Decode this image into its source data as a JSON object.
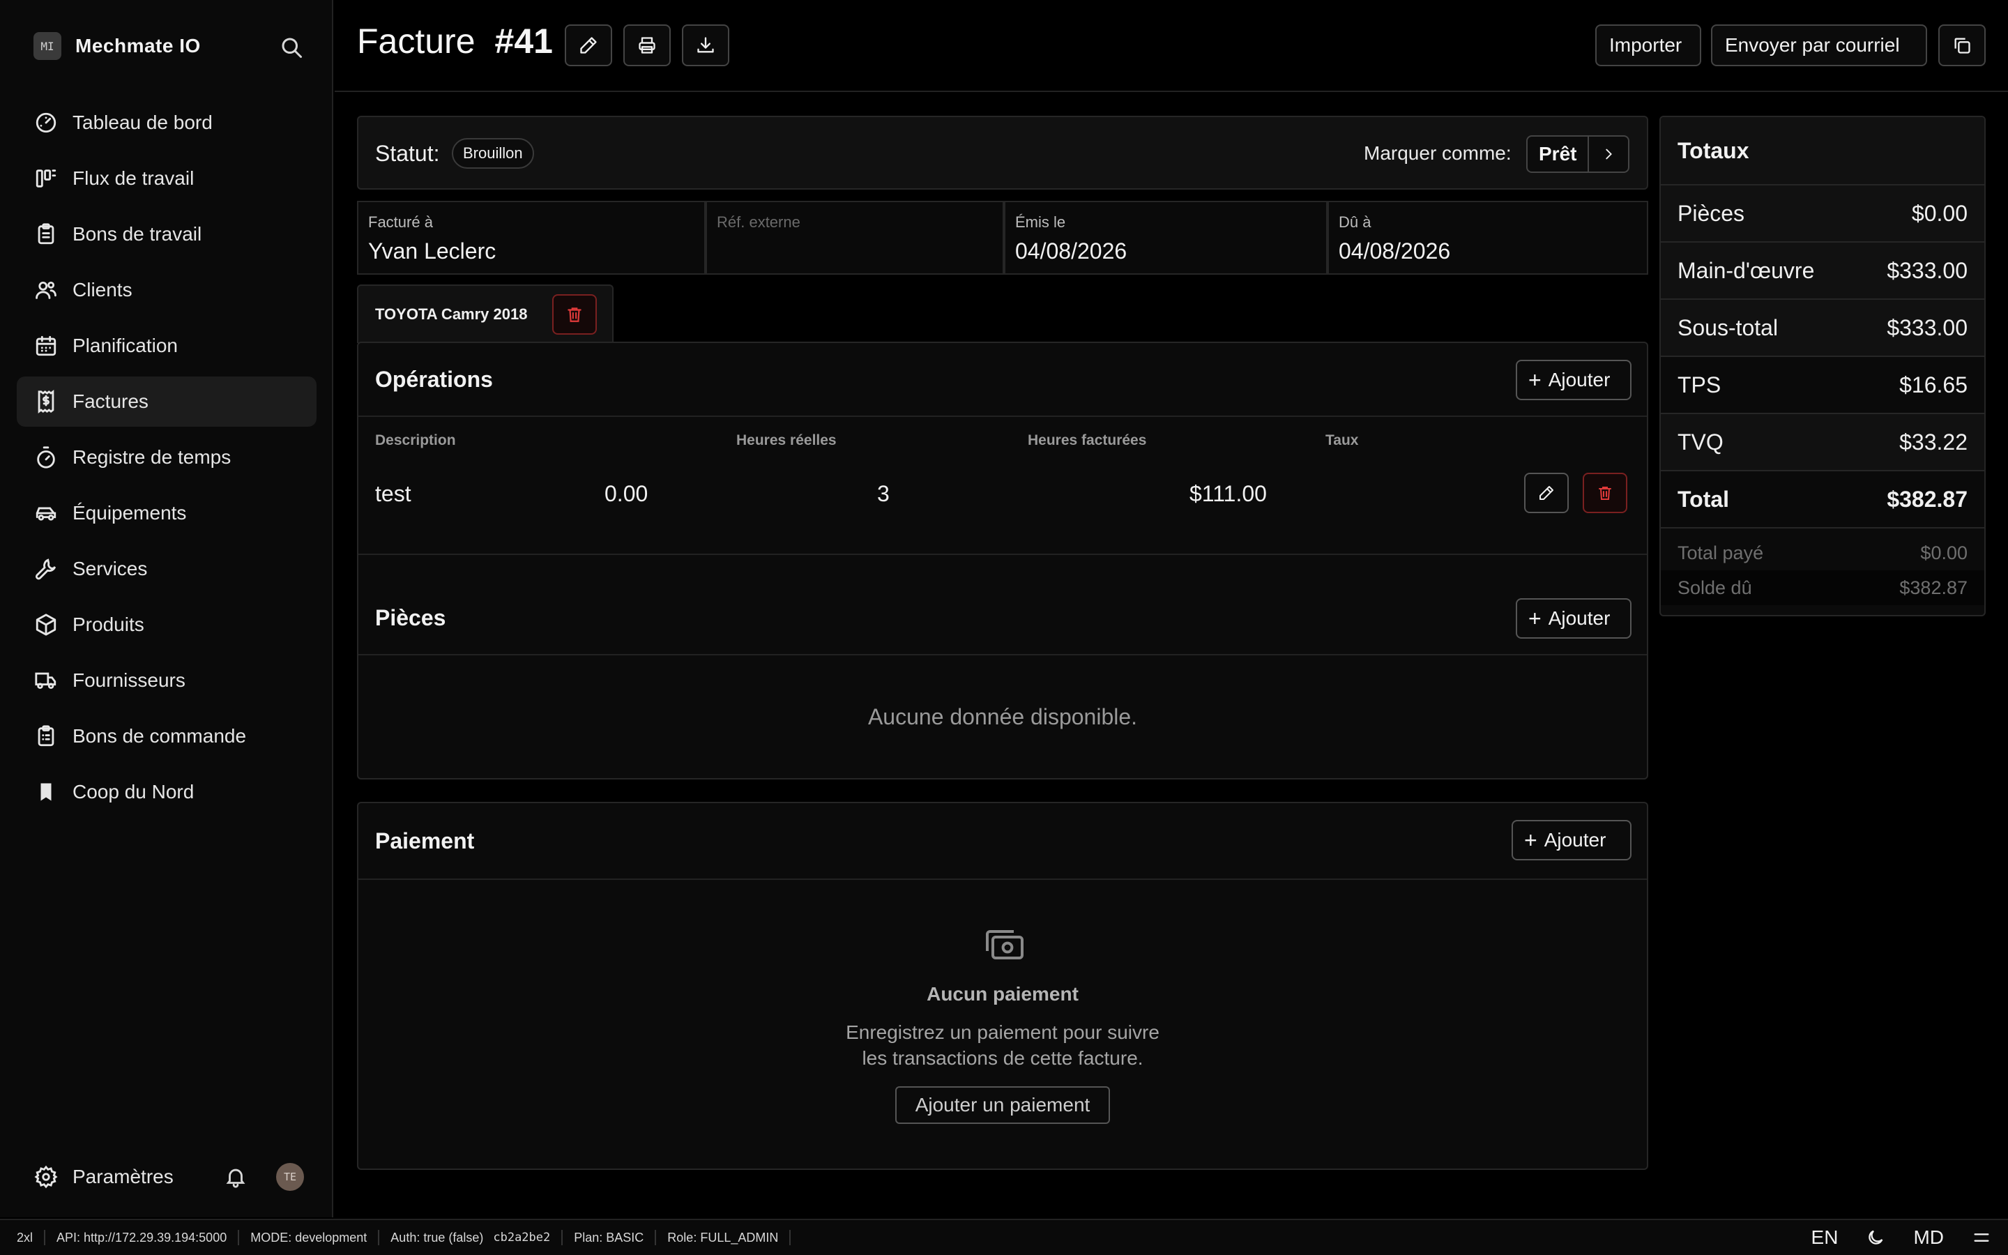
{
  "brand": {
    "badge": "MI",
    "name": "Mechmate IO",
    "search_icon": "search-icon"
  },
  "nav": [
    {
      "label": "Tableau de bord",
      "icon": "gauge-icon"
    },
    {
      "label": "Flux de travail",
      "icon": "workflow-icon"
    },
    {
      "label": "Bons de travail",
      "icon": "clipboard-icon"
    },
    {
      "label": "Clients",
      "icon": "users-icon"
    },
    {
      "label": "Planification",
      "icon": "calendar-icon"
    },
    {
      "label": "Factures",
      "icon": "receipt-icon",
      "active": true
    },
    {
      "label": "Registre de temps",
      "icon": "timer-icon"
    },
    {
      "label": "Équipements",
      "icon": "car-icon"
    },
    {
      "label": "Services",
      "icon": "wrench-icon"
    },
    {
      "label": "Produits",
      "icon": "package-icon"
    },
    {
      "label": "Fournisseurs",
      "icon": "truck-icon"
    },
    {
      "label": "Bons de commande",
      "icon": "clipboard-list-icon"
    },
    {
      "label": "Coop du Nord",
      "icon": "bookmark-icon"
    }
  ],
  "sidebar_bottom": {
    "settings_label": "Paramètres",
    "avatar_initials": "TE"
  },
  "header": {
    "title": "Facture",
    "number": "#41",
    "import_label": "Importer",
    "email_label": "Envoyer par courriel"
  },
  "status": {
    "label": "Statut:",
    "badge": "Brouillon",
    "mark_label": "Marquer comme:",
    "mark_value": "Prêt"
  },
  "fields": {
    "billed_to_label": "Facturé à",
    "billed_to_value": "Yvan Leclerc",
    "ext_ref_placeholder": "Réf. externe",
    "issued_label": "Émis le",
    "issued_value": "04/08/2026",
    "due_label": "Dû à",
    "due_value": "04/08/2026"
  },
  "vehicle_tab": {
    "label": "TOYOTA Camry 2018"
  },
  "operations": {
    "title": "Opérations",
    "add_label": "Ajouter",
    "columns": [
      "Description",
      "Heures réelles",
      "Heures facturées",
      "Taux"
    ],
    "rows": [
      {
        "description": "test",
        "actual_hours": "0.00",
        "billed_hours": "3",
        "rate": "$111.00"
      }
    ]
  },
  "parts": {
    "title": "Pièces",
    "add_label": "Ajouter",
    "empty": "Aucune donnée disponible."
  },
  "payment": {
    "title": "Paiement",
    "add_label": "Ajouter",
    "empty_title": "Aucun paiement",
    "empty_line1": "Enregistrez un paiement pour suivre",
    "empty_line2": "les transactions de cette facture.",
    "add_payment_label": "Ajouter un paiement"
  },
  "totals": {
    "title": "Totaux",
    "rows": [
      {
        "label": "Pièces",
        "value": "$0.00"
      },
      {
        "label": "Main-d'œuvre",
        "value": "$333.00"
      },
      {
        "label": "Sous-total",
        "value": "$333.00"
      },
      {
        "label": "TPS",
        "value": "$16.65"
      },
      {
        "label": "TVQ",
        "value": "$33.22"
      },
      {
        "label": "Total",
        "value": "$382.87"
      }
    ],
    "paid_label": "Total payé",
    "paid_value": "$0.00",
    "balance_label": "Solde dû",
    "balance_value": "$382.87"
  },
  "statusbar": {
    "breakpoint": "2xl",
    "api": "API: http://172.29.39.194:5000",
    "mode": "MODE: development",
    "auth": "Auth: true (false)",
    "commit": "cb2a2be2",
    "plan": "Plan: BASIC",
    "role": "Role: FULL_ADMIN",
    "lang": "EN",
    "user": "MD"
  },
  "colors": {
    "accent_danger": "#dc2626",
    "background": "#000000",
    "panel": "#111111"
  }
}
